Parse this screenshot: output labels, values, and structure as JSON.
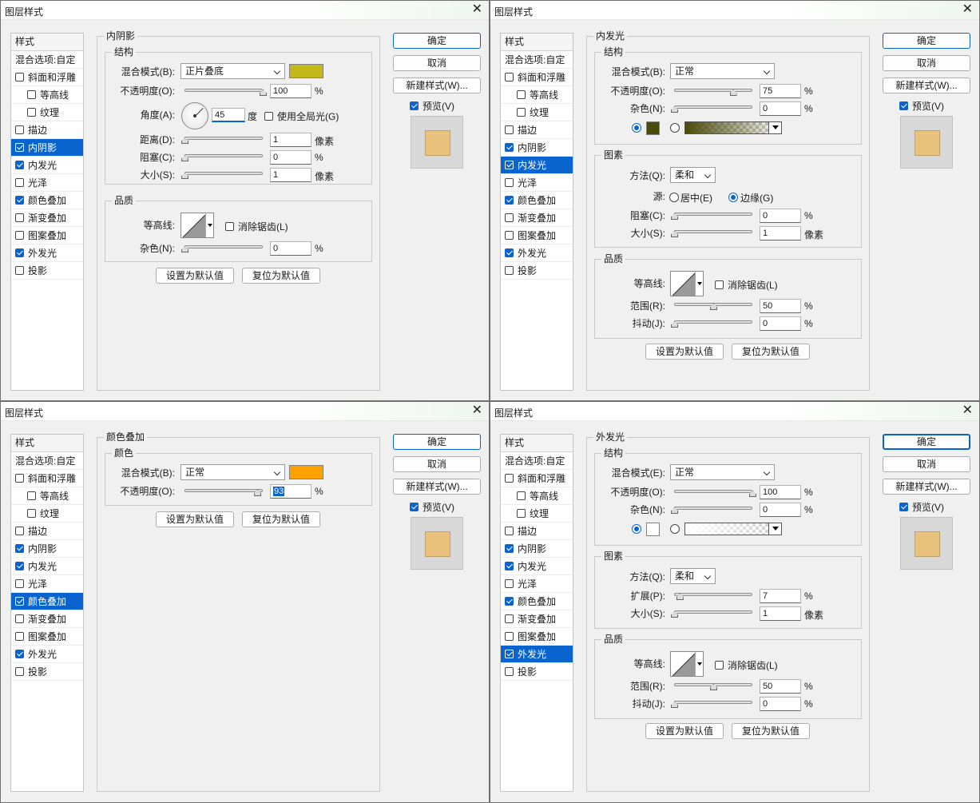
{
  "dialog_title": "图层样式",
  "buttons": {
    "ok": "确定",
    "cancel": "取消",
    "new_style": "新建样式(W)...",
    "preview": "预览(V)",
    "set_default": "设置为默认值",
    "reset_default": "复位为默认值"
  },
  "style_header": "样式",
  "blend_options": "混合选项:自定",
  "style_items": [
    "斜面和浮雕",
    "等高线",
    "纹理",
    "描边",
    "内阴影",
    "内发光",
    "光泽",
    "颜色叠加",
    "渐变叠加",
    "图案叠加",
    "外发光",
    "投影"
  ],
  "preview_color": "#e9c27d",
  "units": {
    "pct": "%",
    "px": "像素",
    "deg": "度"
  },
  "d1": {
    "section": "内阴影",
    "structure": "结构",
    "blend_label": "混合模式(B):",
    "blend_value": "正片叠底",
    "color": "#c4b81a",
    "opacity_label": "不透明度(O):",
    "opacity": "100",
    "angle_label": "角度(A):",
    "angle": "45",
    "global_light": "使用全局光(G)",
    "distance_label": "距离(D):",
    "distance": "1",
    "choke_label": "阻塞(C):",
    "choke": "0",
    "size_label": "大小(S):",
    "size": "1",
    "quality": "品质",
    "contour_label": "等高线:",
    "antialias": "消除锯齿(L)",
    "noise_label": "杂色(N):",
    "noise": "0"
  },
  "d2": {
    "section": "内发光",
    "structure": "结构",
    "blend_label": "混合模式(B):",
    "blend_value": "正常",
    "opacity_label": "不透明度(O):",
    "opacity": "75",
    "noise_label": "杂色(N):",
    "noise": "0",
    "color": "#4a4a0a",
    "elements": "图素",
    "method_label": "方法(Q):",
    "method": "柔和",
    "source_label": "源:",
    "center": "居中(E)",
    "edge": "边缘(G)",
    "choke_label": "阻塞(C):",
    "choke": "0",
    "size_label": "大小(S):",
    "size": "1",
    "quality": "品质",
    "contour_label": "等高线:",
    "antialias": "消除锯齿(L)",
    "range_label": "范围(R):",
    "range": "50",
    "jitter_label": "抖动(J):",
    "jitter": "0"
  },
  "d3": {
    "section": "颜色叠加",
    "color_group": "颜色",
    "blend_label": "混合模式(B):",
    "blend_value": "正常",
    "color": "#ffa200",
    "opacity_label": "不透明度(O):",
    "opacity": "93"
  },
  "d4": {
    "section": "外发光",
    "structure": "结构",
    "blend_label": "混合模式(E):",
    "blend_value": "正常",
    "opacity_label": "不透明度(O):",
    "opacity": "100",
    "noise_label": "杂色(N):",
    "noise": "0",
    "color": "#ffffff",
    "elements": "图素",
    "method_label": "方法(Q):",
    "method": "柔和",
    "spread_label": "扩展(P):",
    "spread": "7",
    "size_label": "大小(S):",
    "size": "1",
    "quality": "品质",
    "contour_label": "等高线:",
    "antialias": "消除锯齿(L)",
    "range_label": "范围(R):",
    "range": "50",
    "jitter_label": "抖动(J):",
    "jitter": "0"
  },
  "slider_levels": {
    "d1": {
      "opacity": 1.0,
      "distance": 0.0,
      "choke": 0.0,
      "size": 0.0,
      "noise": 0.0
    },
    "d2": {
      "opacity": 0.75,
      "noise": 0.0,
      "choke": 0.0,
      "size": 0.0,
      "range": 0.5,
      "jitter": 0.0
    },
    "d3": {
      "opacity": 0.93
    },
    "d4": {
      "opacity": 1.0,
      "noise": 0.0,
      "spread": 0.07,
      "size": 0.0,
      "range": 0.5,
      "jitter": 0.0
    }
  },
  "checked": {
    "d1": [
      4,
      5,
      7,
      10
    ],
    "d2": [
      4,
      5,
      7,
      10
    ],
    "d3": [
      4,
      5,
      7,
      10
    ],
    "d4": [
      4,
      5,
      7,
      10
    ]
  },
  "selected": {
    "d1": 4,
    "d2": 5,
    "d3": 7,
    "d4": 10
  }
}
